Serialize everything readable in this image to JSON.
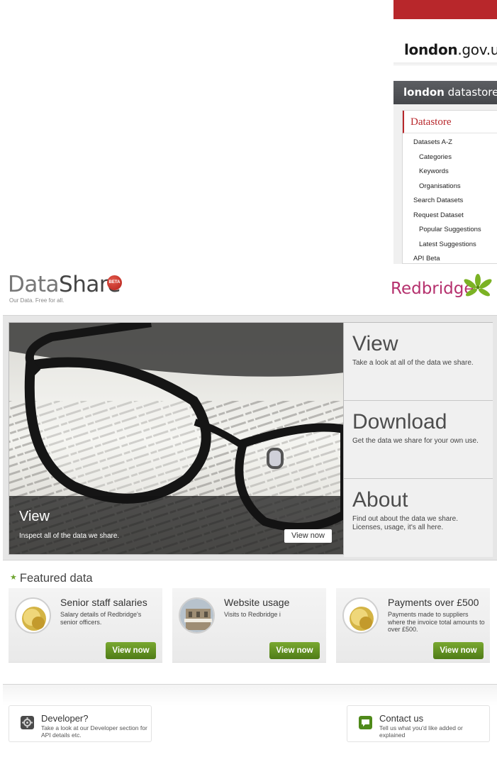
{
  "london": {
    "gov_brand": "london",
    "gov_suffix": ".gov.uk",
    "datastore_brand": "london",
    "datastore_suffix": " datastore",
    "panel_title": "Datastore",
    "menu": [
      {
        "label": "Datasets A-Z",
        "sub": false
      },
      {
        "label": "Categories",
        "sub": true
      },
      {
        "label": "Keywords",
        "sub": true
      },
      {
        "label": "Organisations",
        "sub": true
      },
      {
        "label": "Search Datasets",
        "sub": false
      },
      {
        "label": "Request Dataset",
        "sub": false
      },
      {
        "label": "Popular Suggestions",
        "sub": true
      },
      {
        "label": "Latest Suggestions",
        "sub": true
      },
      {
        "label": "API Beta",
        "sub": false
      }
    ]
  },
  "header": {
    "logo_part1": "Data",
    "logo_part2": "Share",
    "beta": "BETA",
    "tagline": "Our Data. Free for all.",
    "partner": "Redbridge"
  },
  "hero": {
    "caption_title": "View",
    "caption_text": "Inspect all of the data we share.",
    "caption_button": "View now",
    "side": [
      {
        "title": "View",
        "text": "Take a look at all of the data we share."
      },
      {
        "title": "Download",
        "text": "Get the data we share for your own use."
      },
      {
        "title": "About",
        "text": "Find out about the data we share. Licenses, usage, it's all here."
      }
    ]
  },
  "featured": {
    "heading": "Featured data",
    "cards": [
      {
        "title": "Senior staff salaries",
        "text": "Salary details of Redbridge's senior officers.",
        "button": "View now",
        "thumb": "coins"
      },
      {
        "title": "Website usage",
        "text": "Visits to Redbridge i",
        "button": "View now",
        "thumb": "town-hall"
      },
      {
        "title": "Payments over £500",
        "text": "Payments made to suppliers where the invoice total amounts to over £500.",
        "button": "View now",
        "thumb": "coins"
      }
    ]
  },
  "footer": {
    "developer_title": "Developer?",
    "developer_text": "Take a look at our Developer section for API details etc.",
    "contact_title": "Contact us",
    "contact_text": "Tell us what you'd like added or explained"
  },
  "colors": {
    "london_red": "#b8272b",
    "redbridge_magenta": "#b5306d",
    "button_green": "#5e8d1f"
  }
}
